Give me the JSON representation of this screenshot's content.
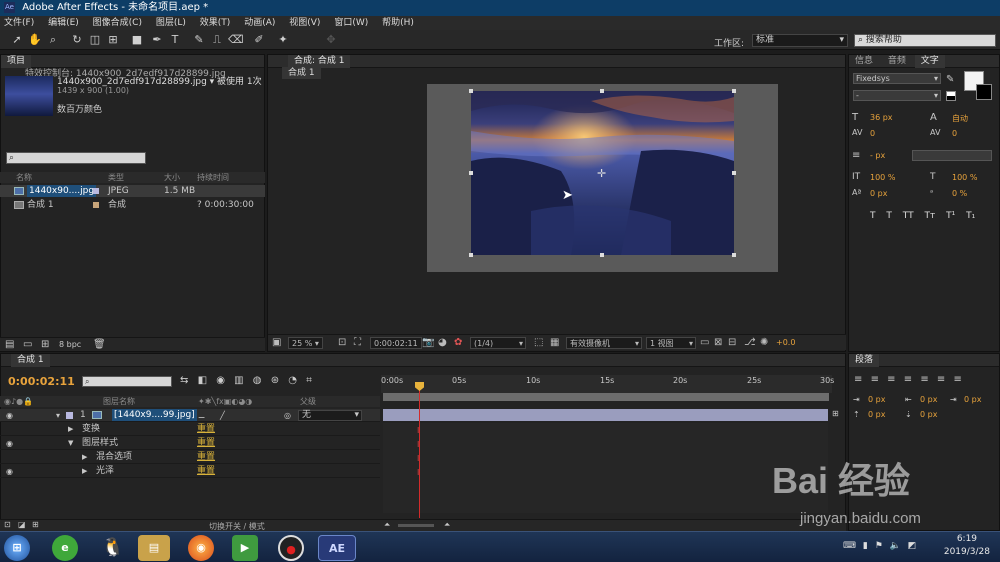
{
  "window": {
    "title": "Adobe After Effects - 未命名项目.aep *",
    "badge": "Ae"
  },
  "menu": [
    "文件(F)",
    "编辑(E)",
    "图像合成(C)",
    "图层(L)",
    "效果(T)",
    "动画(A)",
    "视图(V)",
    "窗口(W)",
    "帮助(H)"
  ],
  "toolbar": {
    "workspace_label": "工作区:",
    "workspace_value": "标准",
    "help_search_placeholder": "搜索帮助"
  },
  "project": {
    "tabs": [
      "项目",
      "特效控制台: 1440x900_2d7edf917d28899.jpg"
    ],
    "selected_name": "1440x900_2d7edf917d28899.jpg ▾ 被使用 1次",
    "selected_dims": "1439 x 900 (1.00)",
    "selected_color": "数百万颜色",
    "columns": [
      "名称",
      "类型",
      "大小",
      "持续时间"
    ],
    "rows": [
      {
        "name": "1440x90....jpg",
        "type": "JPEG",
        "size": "1.5 MB",
        "duration": ""
      },
      {
        "name": "合成 1",
        "type": "合成",
        "size": "",
        "duration": "? 0:00:30:00"
      }
    ],
    "bpc": "8 bpc"
  },
  "composition": {
    "tab": "合成: 合成 1",
    "subtab": "合成 1",
    "zoom": "25 %",
    "timecode": "0:00:02:11",
    "resolution": "(1/4)",
    "camera": "有效摄像机",
    "views": "1 视图",
    "exposure": "+0.0"
  },
  "character": {
    "tabs": [
      "信息",
      "音频",
      "文字"
    ],
    "font": "Fixedsys",
    "style": "-",
    "size": "36 px",
    "leading": "自动",
    "kerning": "0",
    "stroke_unit": "- px",
    "vscale": "100 %",
    "hscale": "100 %",
    "baseline": "0 px",
    "tsume": "0 %",
    "style_buttons": [
      "T",
      "T",
      "TT",
      "Tт",
      "T¹",
      "T₁"
    ]
  },
  "paragraph": {
    "tab": "段落",
    "fields": [
      "0 px",
      "0 px",
      "0 px",
      "0 px",
      "0 px"
    ]
  },
  "timeline": {
    "tab": "合成 1",
    "timecode": "0:00:02:11",
    "columns": [
      "图层名称",
      "父级"
    ],
    "ruler": [
      "0:00s",
      "05s",
      "10s",
      "15s",
      "20s",
      "25s",
      "30s"
    ],
    "layer": {
      "index": "1",
      "name": "[1440x9....99.jpg]",
      "parent": "无"
    },
    "props": [
      {
        "name": "变换",
        "value": "重置"
      },
      {
        "name": "图层样式",
        "value": "重置"
      },
      {
        "name": "混合选项",
        "value": "重置"
      },
      {
        "name": "光泽",
        "value": "重置"
      }
    ],
    "footer": "切换开关 / 模式",
    "cti_fraction": 0.08
  },
  "taskbar": {
    "time": "6:19",
    "date": "2019/3/28",
    "apps": [
      "start",
      "360",
      "qq",
      "explorer",
      "firefox",
      "camtasia",
      "record",
      "ae"
    ]
  },
  "watermark": {
    "brand": "Bai 经验",
    "url": "jingyan.baidu.com"
  }
}
